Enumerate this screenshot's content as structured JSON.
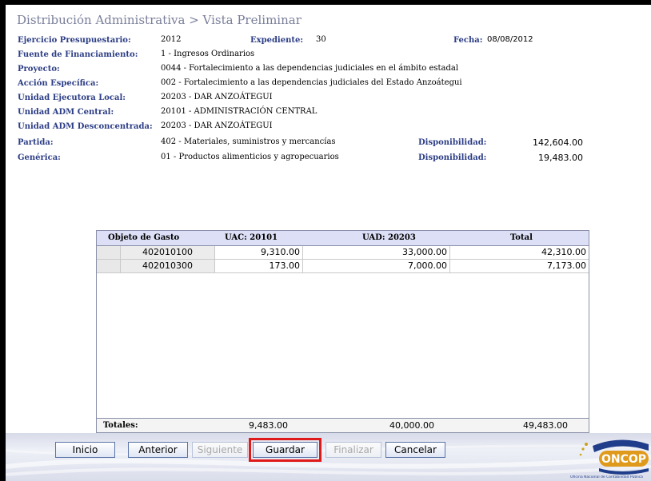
{
  "title": "Distribución Administrativa > Vista Preliminar",
  "info": {
    "ejercicio_label": "Ejercicio Presupuestario:",
    "ejercicio_value": "2012",
    "expediente_label": "Expediente:",
    "expediente_value": "30",
    "fecha_label": "Fecha:",
    "fecha_value": "08/08/2012",
    "fuente_label": "Fuente de Financiamiento:",
    "fuente_value": "1 - Ingresos Ordinarios",
    "proyecto_label": "Proyecto:",
    "proyecto_value": "0044 - Fortalecimiento a las dependencias judiciales en el ámbito estadal",
    "accion_label": "Acción Específica:",
    "accion_value": "002 - Fortalecimiento a las dependencias judiciales del Estado Anzoátegui",
    "uel_label": "Unidad Ejecutora Local:",
    "uel_value": "20203 - DAR ANZOÁTEGUI",
    "uac_label": "Unidad ADM Central:",
    "uac_value": "20101 - ADMINISTRACIÓN CENTRAL",
    "uad_label": "Unidad ADM Desconcentrada:",
    "uad_value": "20203 - DAR ANZOÁTEGUI",
    "partida_label": "Partida:",
    "partida_value": "402 - Materiales, suministros y mercancías",
    "disp1_label": "Disponibilidad:",
    "disp1_value": "142,604.00",
    "generica_label": "Genérica:",
    "generica_value": "01 - Productos alimenticios y agropecuarios",
    "disp2_label": "Disponibilidad:",
    "disp2_value": "19,483.00"
  },
  "table": {
    "headers": {
      "objeto": "Objeto de Gasto",
      "uac": "UAC: 20101",
      "uad": "UAD: 20203",
      "total": "Total"
    },
    "rows": [
      {
        "code": "402010100",
        "uac": "9,310.00",
        "uad": "33,000.00",
        "total": "42,310.00"
      },
      {
        "code": "402010300",
        "uac": "173.00",
        "uad": "7,000.00",
        "total": "7,173.00"
      }
    ],
    "totals": {
      "label": "Totales:",
      "uac": "9,483.00",
      "uad": "40,000.00",
      "total": "49,483.00"
    }
  },
  "buttons": {
    "inicio": "Inicio",
    "anterior": "Anterior",
    "siguiente": "Siguiente",
    "guardar": "Guardar",
    "finalizar": "Finalizar",
    "cancelar": "Cancelar"
  },
  "logo": {
    "name": "ONCOP",
    "caption": "Oficina Nacional de Contabilidad Pública"
  },
  "colors": {
    "label": "#2c3d85",
    "header_bg": "#dcdff5",
    "highlight": "#e01a1a"
  }
}
